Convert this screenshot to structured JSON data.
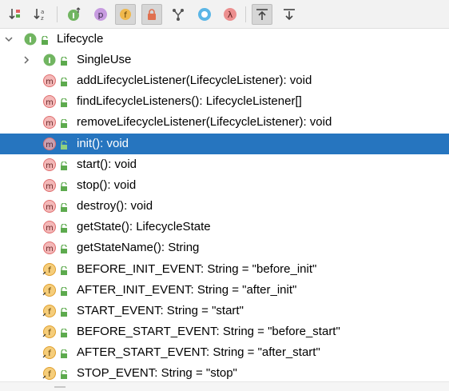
{
  "colors": {
    "selection": "#2675bf",
    "interface": "#71b561",
    "method": "#e07070",
    "field": "#f0b84c",
    "lock": "#5daa4e"
  },
  "toolbar": {
    "buttons": [
      {
        "name": "sort-by-visibility-button",
        "icon": "sort-visibility-icon"
      },
      {
        "name": "sort-alphabetically-button",
        "icon": "sort-alpha-icon"
      },
      {
        "name": "show-inherited-button",
        "icon": "inherited-icon"
      },
      {
        "name": "show-properties-button",
        "icon": "property-icon"
      },
      {
        "name": "show-fields-button",
        "icon": "field-icon"
      },
      {
        "name": "show-non-public-button",
        "icon": "lock-icon"
      },
      {
        "name": "show-hierarchy-button",
        "icon": "hierarchy-icon"
      },
      {
        "name": "show-anonymous-button",
        "icon": "anonymous-icon"
      },
      {
        "name": "show-lambdas-button",
        "icon": "lambda-icon"
      },
      {
        "name": "autoscroll-to-source-button",
        "icon": "autoscroll-to-icon"
      },
      {
        "name": "autoscroll-from-source-button",
        "icon": "autoscroll-from-icon"
      }
    ],
    "property_glyph": "p",
    "field_glyph": "f",
    "lambda_glyph": "λ"
  },
  "tree": {
    "root": {
      "label": "Lifecycle",
      "kind": "interface",
      "glyph": "I",
      "expanded": true
    },
    "items": [
      {
        "label": "SingleUse",
        "kind": "interface",
        "glyph": "I",
        "collapsed": true
      },
      {
        "label": "addLifecycleListener(LifecycleListener): void",
        "kind": "method",
        "glyph": "m"
      },
      {
        "label": "findLifecycleListeners(): LifecycleListener[]",
        "kind": "method",
        "glyph": "m"
      },
      {
        "label": "removeLifecycleListener(LifecycleListener): void",
        "kind": "method",
        "glyph": "m"
      },
      {
        "label": "init(): void",
        "kind": "method",
        "glyph": "m",
        "selected": true
      },
      {
        "label": "start(): void",
        "kind": "method",
        "glyph": "m"
      },
      {
        "label": "stop(): void",
        "kind": "method",
        "glyph": "m"
      },
      {
        "label": "destroy(): void",
        "kind": "method",
        "glyph": "m"
      },
      {
        "label": "getState(): LifecycleState",
        "kind": "method",
        "glyph": "m"
      },
      {
        "label": "getStateName(): String",
        "kind": "method",
        "glyph": "m"
      },
      {
        "label": "BEFORE_INIT_EVENT: String = \"before_init\"",
        "kind": "field",
        "glyph": "f"
      },
      {
        "label": "AFTER_INIT_EVENT: String = \"after_init\"",
        "kind": "field",
        "glyph": "f"
      },
      {
        "label": "START_EVENT: String = \"start\"",
        "kind": "field",
        "glyph": "f"
      },
      {
        "label": "BEFORE_START_EVENT: String = \"before_start\"",
        "kind": "field",
        "glyph": "f"
      },
      {
        "label": "AFTER_START_EVENT: String = \"after_start\"",
        "kind": "field",
        "glyph": "f"
      },
      {
        "label": "STOP_EVENT: String = \"stop\"",
        "kind": "field",
        "glyph": "f"
      }
    ]
  }
}
